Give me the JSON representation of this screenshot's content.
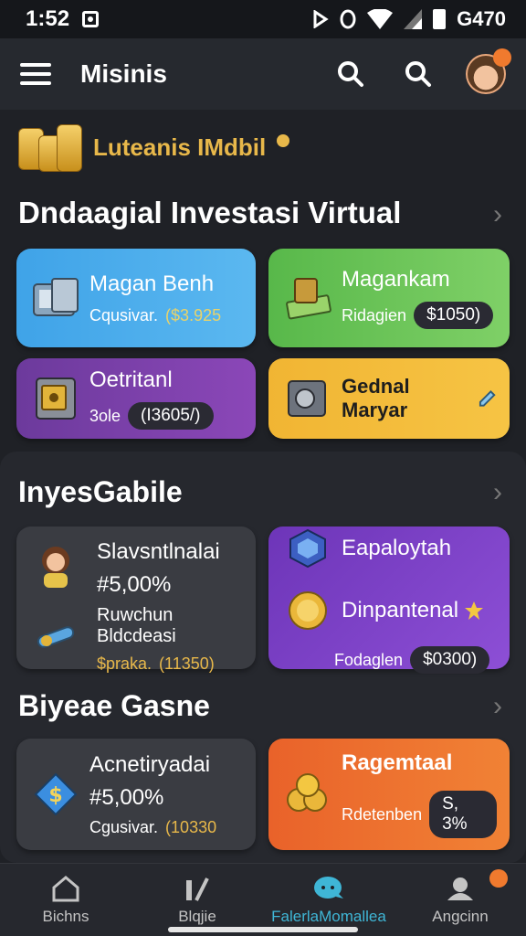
{
  "status_bar": {
    "time": "1:52",
    "battery_text": "G470"
  },
  "app_bar": {
    "title": "Misinis"
  },
  "banner": {
    "text": "Luteanis IMdbil"
  },
  "section1": {
    "title": "Dndaagial  Investasi Virtual",
    "cards": [
      {
        "title": "Magan Benh",
        "sub_label": "Cqusivar.",
        "sub_value": "($3.925"
      },
      {
        "title": "Magankam",
        "sub_label": "Ridagien",
        "sub_value": "$1050)"
      },
      {
        "title": "Oetritanl",
        "sub_label": "3ole",
        "sub_value": "(I3605/)"
      },
      {
        "title": "Gednal Maryar"
      }
    ]
  },
  "section2": {
    "title": "InyesGabile",
    "left_card": {
      "title": "Slavsntlnalai",
      "percent": "#5,00%",
      "sub_title": "Ruwchun Bldcdeasi",
      "sub_label": "$praka.",
      "sub_value": "(11350)"
    },
    "right_card": {
      "title": "Eapaloytah",
      "sub_title": "Dinpantenal",
      "sub_label": "Fodaglen",
      "sub_value": "$0300)"
    }
  },
  "section3": {
    "title": "Biyeae Gasne",
    "left_card": {
      "title": "Acnetiryadai",
      "percent": "#5,00%",
      "sub_label": "Cgusivar.",
      "sub_value": "(10330"
    },
    "right_card": {
      "title": "Ragemtaal",
      "sub_label": "Rdetenben",
      "sub_value": "S, 3%"
    }
  },
  "bottom_nav": [
    {
      "label": "Bichns",
      "icon": "home-icon"
    },
    {
      "label": "Blqjie",
      "icon": "chart-icon"
    },
    {
      "label": "FalerlaMomallea",
      "icon": "chat-icon",
      "active": true
    },
    {
      "label": "Angcinn",
      "icon": "profile-icon"
    }
  ],
  "colors": {
    "active": "#3fb6d6",
    "badge": "#f07a2e",
    "gold": "#e8b84a"
  }
}
